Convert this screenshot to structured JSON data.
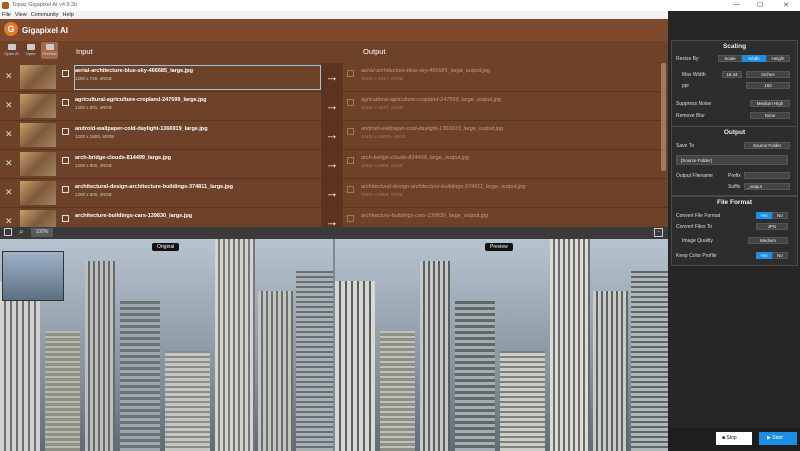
{
  "window": {
    "title": "Topaz Gigapixel AI v4.9.3b",
    "minimize": "—",
    "maximize": "☐",
    "close": "✕"
  },
  "menu": [
    "File",
    "View",
    "Community",
    "Help"
  ],
  "app": {
    "logo": "G",
    "name": "Gigapixel AI"
  },
  "toolbar": {
    "open": "Open AI",
    "open2": "Open",
    "preview": "Preview"
  },
  "list": {
    "input_header": "Input",
    "output_header": "Output"
  },
  "rows": [
    {
      "in": "aerial-architecture-blue-sky-466685_large.jpg",
      "in_dim": "1200 x 745, sRGB",
      "out": "aerial-architecture-blue-sky-466685_large_output.jpg",
      "out_dim": "10452 x 6417, sRGB"
    },
    {
      "in": "agricultural-agriculture-cropland-247599_large.jpg",
      "in_dim": "1200 x 801, sRGB",
      "out": "agricultural-agriculture-cropland-247599_large_output.jpg",
      "out_dim": "10452 x 6977, sRGB"
    },
    {
      "in": "android-wallpaper-cold-daylight-1366919_large.jpg",
      "in_dim": "1200 x 1800, sRGB",
      "out": "android-wallpaper-cold-daylight-1366919_large_output.jpg",
      "out_dim": "10452 x 15678, sRGB"
    },
    {
      "in": "arch-bridge-clouds-814499_large.jpg",
      "in_dim": "1200 x 800, sRGB",
      "out": "arch-bridge-clouds-814499_large_output.jpg",
      "out_dim": "10452 x 6968, sRGB"
    },
    {
      "in": "architectural-design-architecture-buildings-374811_large.jpg",
      "in_dim": "1200 x 800, sRGB",
      "out": "architectural-design-architecture-buildings-374811_large_output.jpg",
      "out_dim": "10452 x 6968, sRGB"
    },
    {
      "in": "architecture-buildings-cars-139830_large.jpg",
      "in_dim": "",
      "out": "architecture-buildings-cars-139830_large_output.jpg",
      "out_dim": ""
    }
  ],
  "view": {
    "zoom": "100%",
    "original": "Original",
    "preview": "Preview"
  },
  "scaling": {
    "title": "Scaling",
    "resize_by": "Resize By",
    "scale": "Scale",
    "width": "Width",
    "height": "Height",
    "max_width": "Max Width",
    "max_width_val": "16.44",
    "unit": "Inches",
    "ppi": "ppi",
    "ppi_val": "150",
    "suppress_noise": "Suppress Noise",
    "noise_val": "Medium High",
    "remove_blur": "Remove Blur",
    "blur_val": "None"
  },
  "output": {
    "title": "Output",
    "save_to": "Save To",
    "save_val": "Source Folder",
    "source_folder": "[Source Folder]",
    "filename": "Output Filename",
    "prefix": "Prefix",
    "suffix": "Suffix",
    "suffix_val": "_output"
  },
  "format": {
    "title": "File Format",
    "convert_format": "Convert File Format",
    "yes": "Yes",
    "no": "No",
    "convert_to": "Convert Files To",
    "jpg": "JPG",
    "quality": "Image Quality",
    "quality_val": "Medium",
    "keep_profile": "Keep Color Profile"
  },
  "actions": {
    "stop": "Stop",
    "start": "Start"
  },
  "colors": {
    "accent": "#1b8fe6",
    "brown": "#6e4229"
  }
}
